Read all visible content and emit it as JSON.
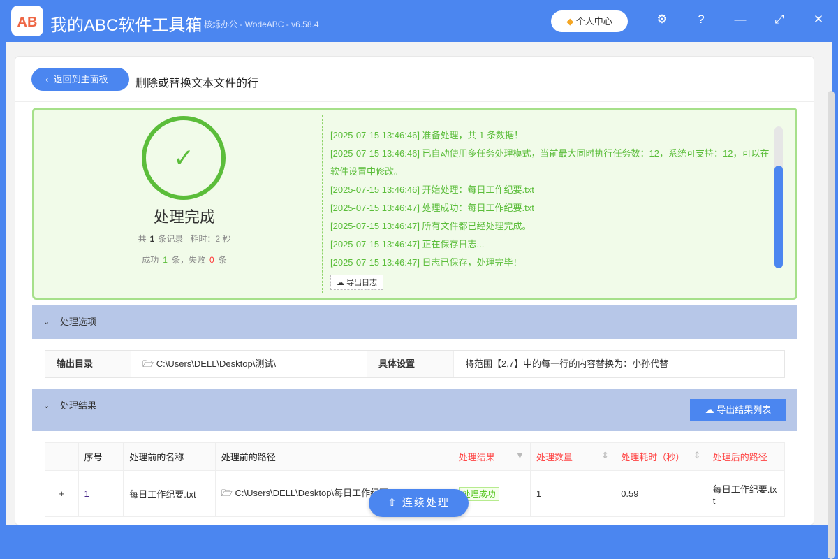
{
  "app": {
    "logo": "AB",
    "title": "我的ABC软件工具箱",
    "subtitle": "核烁办公 - WodeABC - v6.58.4",
    "user_center": "个人中心"
  },
  "page": {
    "back": "返回到主面板",
    "title": "删除或替换文本文件的行"
  },
  "summary": {
    "status": "处理完成",
    "total_prefix": "共",
    "total": "1",
    "total_suffix": "条记录",
    "time_label": "耗时：2 秒",
    "success_prefix": "成功",
    "success": "1",
    "success_mid": "条，失败",
    "fail": "0",
    "fail_suffix": "条"
  },
  "log": [
    "[2025-07-15 13:46:46] 准备处理，共 1 条数据！",
    "[2025-07-15 13:46:46] 已自动使用多任务处理模式，当前最大同时执行任务数：12，系统可支持：12，可以在软件设置中修改。",
    "[2025-07-15 13:46:46] 开始处理：每日工作纪要.txt",
    "[2025-07-15 13:46:47] 处理成功：每日工作纪要.txt",
    "[2025-07-15 13:46:47] 所有文件都已经处理完成。",
    "[2025-07-15 13:46:47] 正在保存日志...",
    "[2025-07-15 13:46:47] 日志已保存，处理完毕！"
  ],
  "export_log": "导出日志",
  "options": {
    "title": "处理选项",
    "output_label": "输出目录",
    "output_value": "C:\\Users\\DELL\\Desktop\\测试\\",
    "settings_label": "具体设置",
    "settings_value": "将范围【2,7】中的每一行的内容替换为：小孙代替"
  },
  "results": {
    "title": "处理结果",
    "export": "导出结果列表",
    "headers": [
      "序号",
      "处理前的名称",
      "处理前的路径",
      "处理结果",
      "处理数量",
      "处理耗时（秒）",
      "处理后的路径"
    ],
    "rows": [
      {
        "index": "1",
        "name": "每日工作纪要.txt",
        "path": "C:\\Users\\DELL\\Desktop\\每日工作纪要.txt",
        "result": "处理成功",
        "count": "1",
        "time": "0.59",
        "out": "每日工作纪要.txt"
      }
    ]
  },
  "continue": "连续处理"
}
